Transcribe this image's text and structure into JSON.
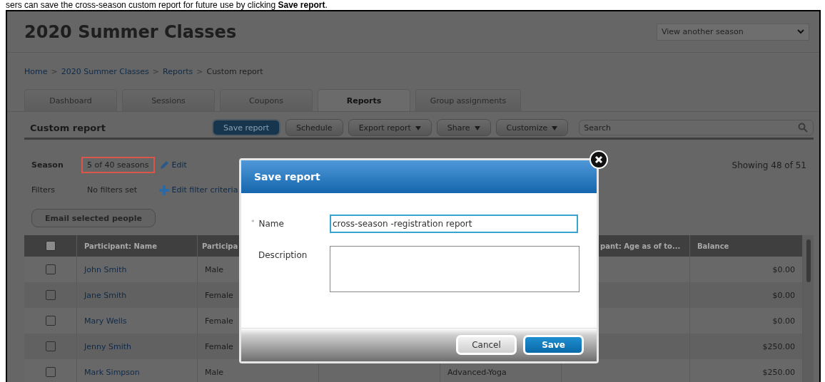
{
  "caption": "sers can save the cross-season custom report for future use by clicking **Save report**.",
  "header": {
    "title": "2020 Summer Classes",
    "season_select": "View another season"
  },
  "breadcrumb": [
    {
      "label": "Home",
      "current": false
    },
    {
      "label": "2020 Summer Classes",
      "current": false
    },
    {
      "label": "Reports",
      "current": false
    },
    {
      "label": "Custom report",
      "current": true
    }
  ],
  "breadcrumb_separator": ">",
  "tabs": [
    {
      "label": "Dashboard",
      "selected": false
    },
    {
      "label": "Sessions",
      "selected": false
    },
    {
      "label": "Coupons",
      "selected": false
    },
    {
      "label": "Reports",
      "selected": true
    },
    {
      "label": "Group assignments",
      "selected": false
    }
  ],
  "report": {
    "title": "Custom report",
    "toolbar": [
      {
        "label": "Save report",
        "kind": "primary"
      },
      {
        "label": "Schedule",
        "kind": "plain"
      },
      {
        "label": "Export report",
        "kind": "menu"
      },
      {
        "label": "Share",
        "kind": "menu"
      },
      {
        "label": "Customize",
        "kind": "menu"
      }
    ],
    "search": {
      "placeholder": "Search"
    },
    "season_label": "Season",
    "season_value": "5 of 40 seasons",
    "season_highlighted": true,
    "season_edit": "Edit",
    "filters_label": "Filters",
    "filters_value": "No filters set",
    "filters_edit": "Edit filter criteria",
    "showing": "Showing 48 of 51",
    "email_button": "Email selected people"
  },
  "table": {
    "columns": {
      "all_checked": false,
      "name": "Participant: Name",
      "column_3": "Participa",
      "column_6": "pant: Age as of to...",
      "balance": "Balance"
    },
    "rows": [
      {
        "checked": false,
        "name": "John Smith",
        "column_3": "Male",
        "balance": "$0.00"
      },
      {
        "checked": false,
        "name": "Jane Smith",
        "column_3": "Female",
        "balance": "$0.00"
      },
      {
        "checked": false,
        "name": "Mary Wells",
        "column_3": "Female",
        "balance": "$0.00"
      },
      {
        "checked": false,
        "name": "Jenny Smith",
        "column_3": "Female",
        "balance": "$250.00"
      },
      {
        "checked": false,
        "name": "Mark Simpson",
        "column_3": "Male",
        "column_5": "Advanced-Yoga",
        "balance": "$250.00"
      }
    ]
  },
  "dialog": {
    "title": "Save report",
    "required_mark": "*",
    "name_label": "Name",
    "name_value": "cross-season -registration report",
    "description_label": "Description",
    "buttons": [
      {
        "label": "Cancel",
        "kind": "secondary"
      },
      {
        "label": "Save",
        "kind": "primary"
      }
    ]
  }
}
